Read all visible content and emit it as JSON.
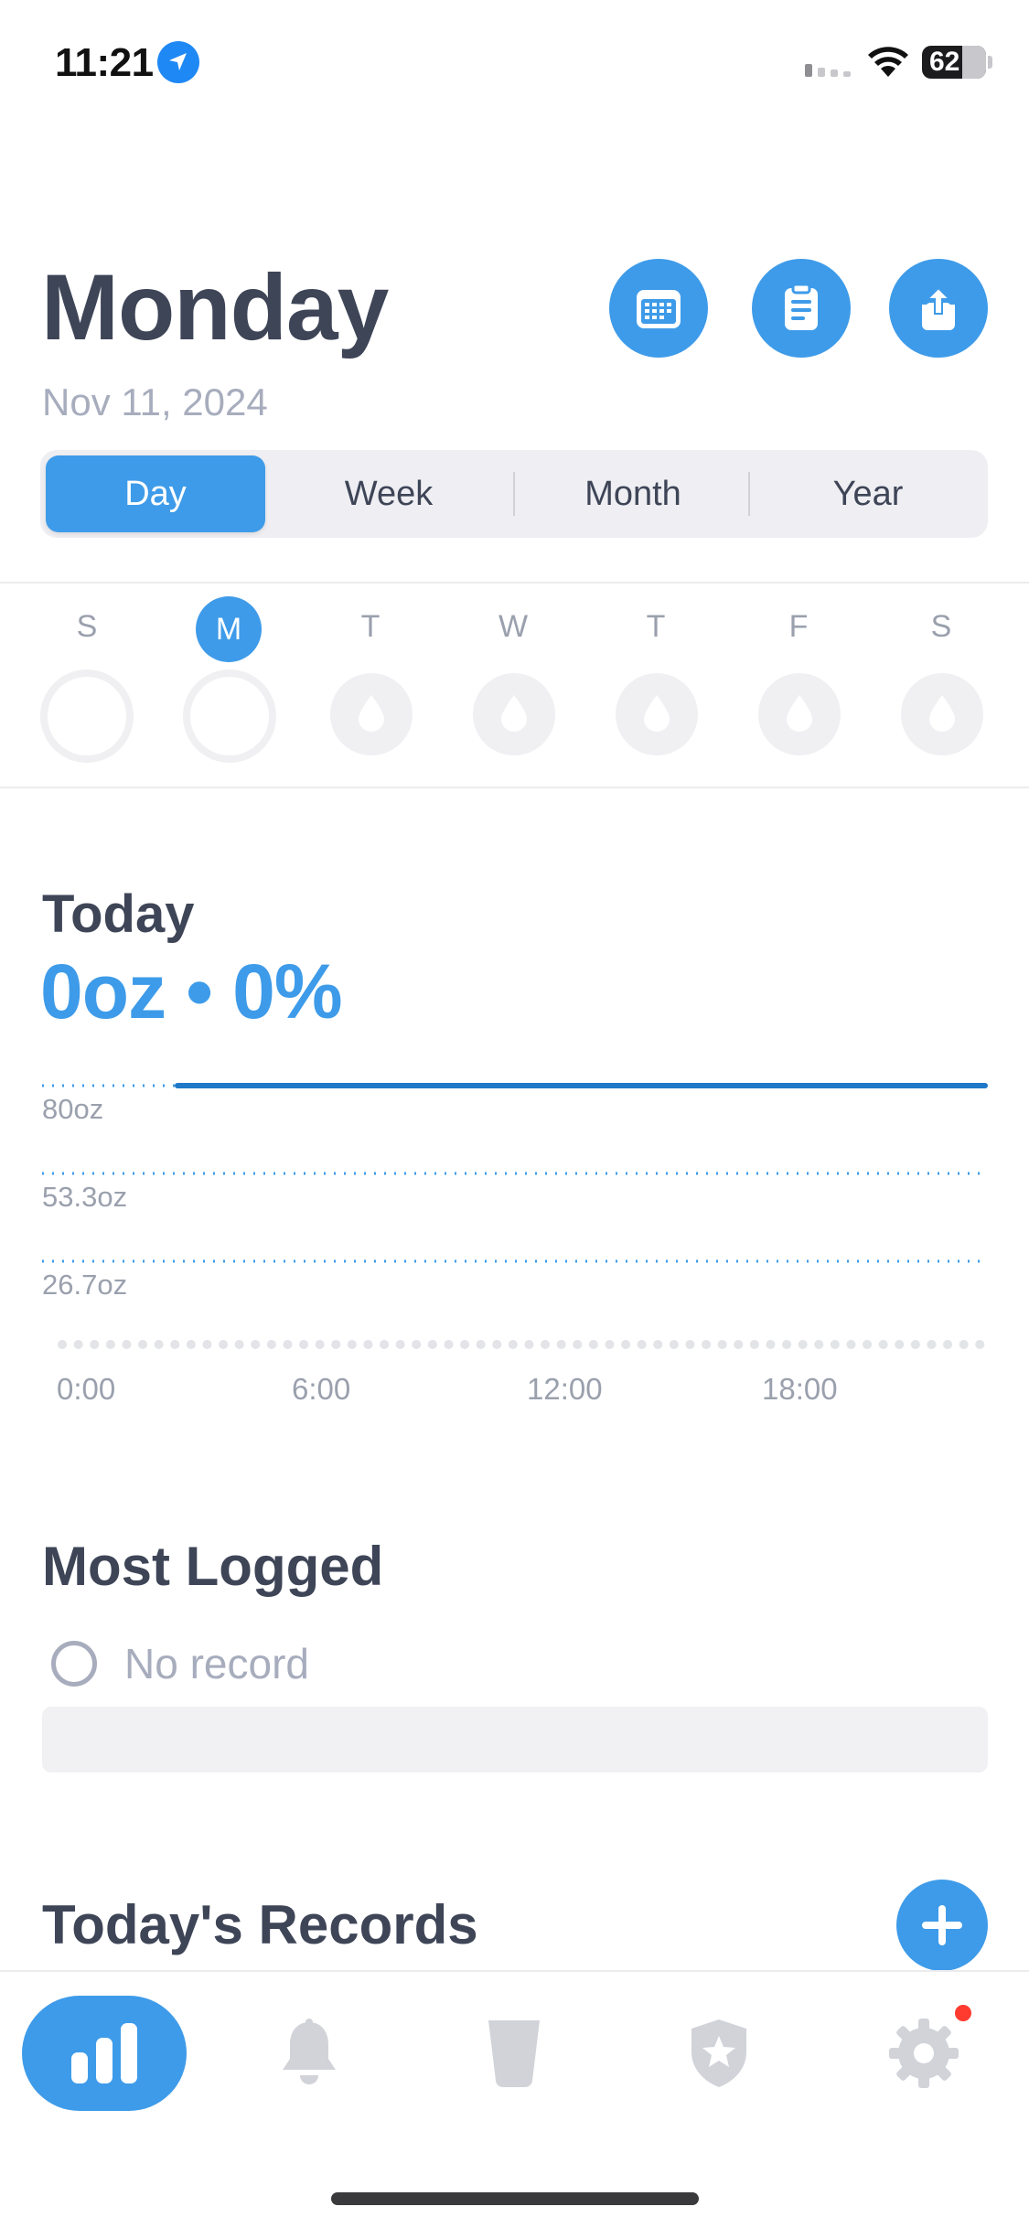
{
  "status_bar": {
    "time": "11:21",
    "battery": "62"
  },
  "header": {
    "title": "Monday",
    "date": "Nov 11, 2024",
    "buttons": [
      "calendar-icon",
      "clipboard-icon",
      "share-icon"
    ]
  },
  "segmented_control": {
    "items": [
      "Day",
      "Week",
      "Month",
      "Year"
    ],
    "selected": "Day"
  },
  "week_strip": {
    "days": [
      "S",
      "M",
      "T",
      "W",
      "T",
      "F",
      "S"
    ],
    "selected_index": 1
  },
  "today": {
    "label": "Today",
    "value": "0oz • 0%"
  },
  "chart_data": {
    "type": "line",
    "y_ticks": [
      "80oz",
      "53.3oz",
      "26.7oz"
    ],
    "x_ticks": [
      "0:00",
      "6:00",
      "12:00",
      "18:00"
    ],
    "goal_line": 80
  },
  "most_logged": {
    "title": "Most Logged",
    "empty_text": "No record"
  },
  "records": {
    "title": "Today's Records"
  },
  "tab_bar": {
    "items": [
      "chart-icon",
      "bell-icon",
      "cup-icon",
      "shield-star-icon",
      "gear-icon"
    ],
    "active_index": 0
  },
  "colors": {
    "accent": "#3e9be9",
    "goal_line": "#1f78c8",
    "text": "#3e4557",
    "muted": "#a7adbd"
  }
}
